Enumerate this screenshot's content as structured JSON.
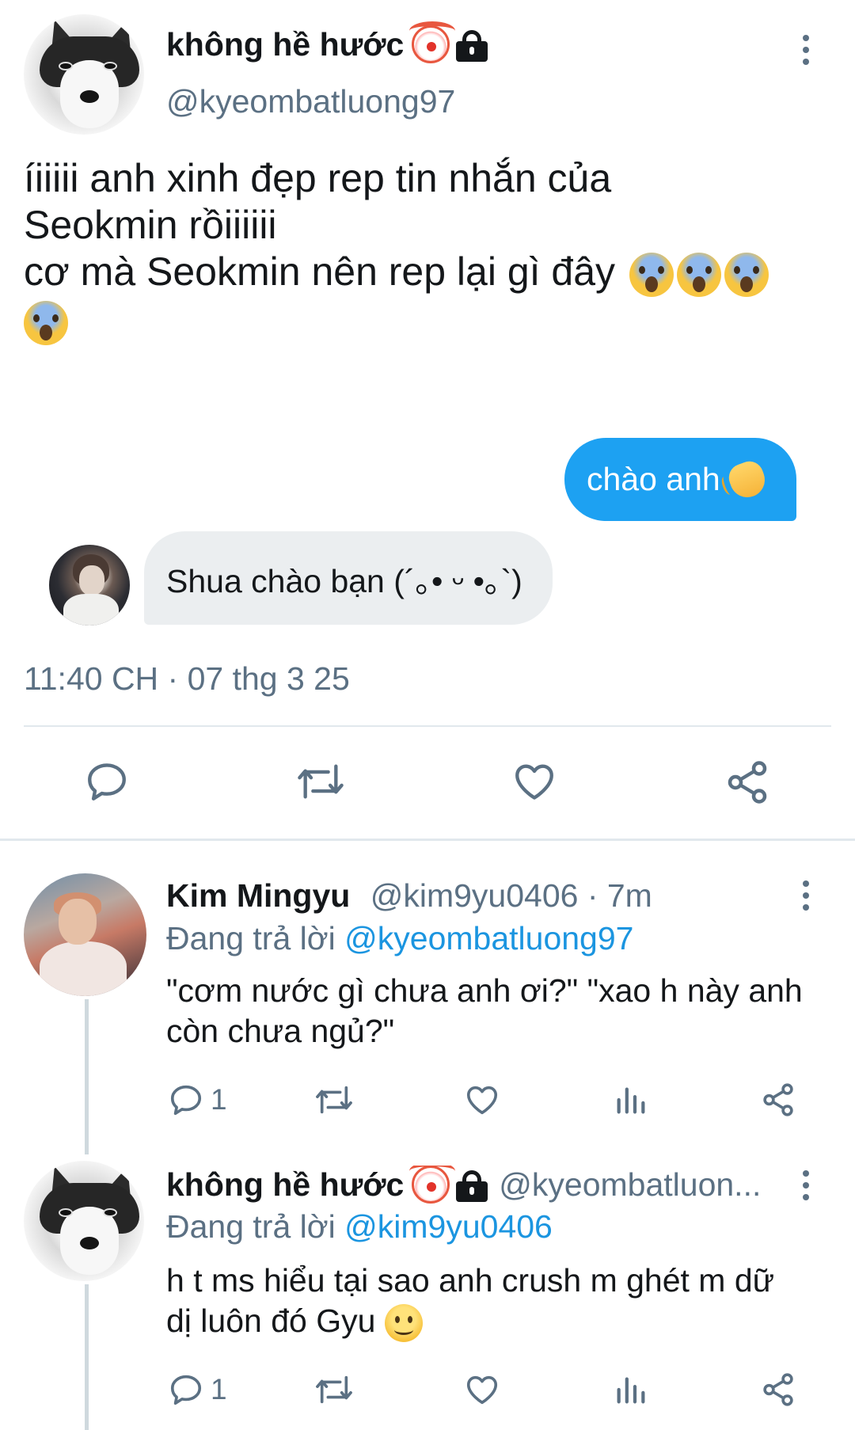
{
  "main_tweet": {
    "author": {
      "display_name": "không hề hước",
      "handle": "@kyeombatluong97",
      "badges": [
        "clown-face-emoji",
        "lock-icon"
      ]
    },
    "text_line1": "íiiiii anh xinh đẹp rep tin nhắn của",
    "text_line2": "Seokmin rồiiiiii",
    "text_line3": "cơ mà Seokmin nên rep lại gì đây",
    "trailing_emoji": "face-screaming-in-fear",
    "chat": {
      "outgoing": "chào anh",
      "outgoing_emoji": "waving-hand",
      "incoming": "Shua chào bạn (´｡• ᵕ •｡`)"
    },
    "timestamp": "11:40 CH · 07 thg 3 25",
    "actions": [
      "reply-icon",
      "retweet-icon",
      "like-icon",
      "share-icon"
    ]
  },
  "replies": [
    {
      "display_name": "Kim Mingyu",
      "handle_time": "@kim9yu0406 · 7m",
      "replying_prefix": "Đang trả lời",
      "replying_to": "@kyeombatluong97",
      "text_line1": "\"cơm nước gì chưa anh ơi?\" \"xao h này anh",
      "text_line2": "còn chưa ngủ?\"",
      "reply_count": "1"
    },
    {
      "display_name": "không hề hước",
      "handle_time": "@kyeombatluon...",
      "replying_prefix": "Đang trả lời",
      "replying_to": "@kim9yu0406",
      "text_line1": "h t ms hiểu tại sao anh crush m ghét m dữ",
      "text_line2": "dị luôn đó Gyu",
      "trailing_emoji": "slightly-smiling-face",
      "reply_count": "1"
    }
  ],
  "colors": {
    "accent": "#1da1f2",
    "mention": "#1b95e0",
    "secondary_text": "#5b7083",
    "incoming_bubble": "#ebeef0"
  }
}
